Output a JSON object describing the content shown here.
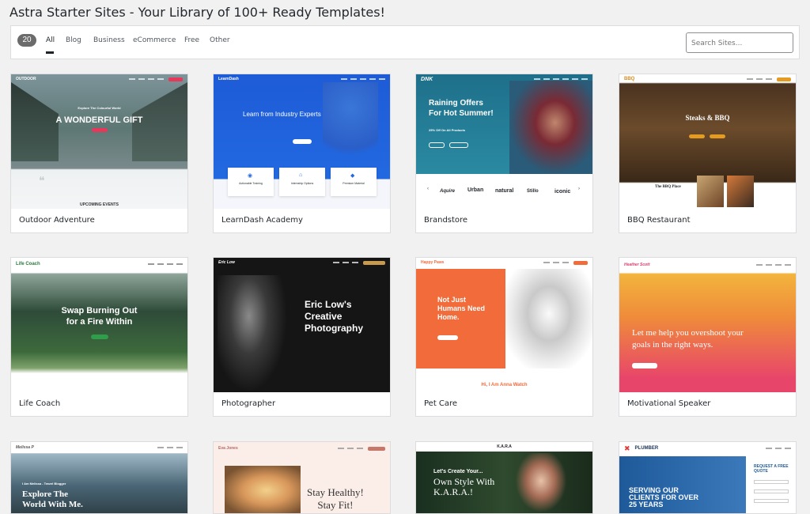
{
  "title": "Astra Starter Sites - Your Library of 100+ Ready Templates!",
  "filters": {
    "count": "20",
    "items": [
      "All",
      "Blog",
      "Business",
      "eCommerce",
      "Free",
      "Other"
    ],
    "active": "All"
  },
  "search": {
    "placeholder": "Search Sites..."
  },
  "sites": [
    {
      "name": "Outdoor Adventure",
      "hero": "A WONDERFUL GIFT",
      "kicker": "Explore The Colourful World",
      "logo": "OUTDOOR",
      "section": "UPCOMING EVENTS"
    },
    {
      "name": "LearnDash Academy",
      "hero": "Learn from Industry Experts",
      "logo": "LearnDash",
      "features": [
        "Actionable Training",
        "Internship Options",
        "Premium Material"
      ]
    },
    {
      "name": "Brandstore",
      "hero": "Raining Offers\nFor Hot Summer!",
      "sub": "25% Off On All Products",
      "logo": "DNK",
      "brands": [
        "Aquire",
        "Urban",
        "natural",
        "Stillo",
        "iconic"
      ]
    },
    {
      "name": "BBQ Restaurant",
      "hero": "Steaks & BBQ",
      "logo": "BBQ",
      "section": "The BBQ Place"
    },
    {
      "name": "Life Coach",
      "hero": "Swap Burning Out\nfor a Fire Within",
      "logo": "Life Coach"
    },
    {
      "name": "Photographer",
      "hero": "Eric Low's\nCreative\nPhotography",
      "logo": "Eric Low"
    },
    {
      "name": "Pet Care",
      "hero": "Not Just\nHumans Need\nHome.",
      "logo": "Happy Paws",
      "footer": "Hi, I Am Anna Watch"
    },
    {
      "name": "Motivational Speaker",
      "hero": "Let me help you overshoot your\ngoals in the right ways.",
      "logo": "Heather Scott"
    },
    {
      "name": "",
      "hero": "Explore The\nWorld With Me.",
      "kicker": "I Am Melissa - Travel Blogger",
      "logo": "Melissa P"
    },
    {
      "name": "",
      "hero": "Stay Healthy!\nStay Fit!",
      "logo": "Eva Jones"
    },
    {
      "name": "",
      "hero": "Own Style With\nK.A.R.A.!",
      "kicker": "Let's Create Your...",
      "logo": "K.A.R.A"
    },
    {
      "name": "",
      "hero": "SERVING OUR\nCLIENTS FOR OVER\n25 YEARS",
      "logo": "PLUMBER",
      "form": "REQUEST A FREE QUOTE"
    }
  ]
}
